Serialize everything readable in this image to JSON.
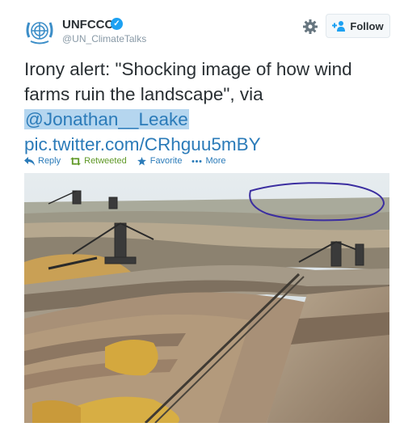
{
  "account": {
    "name": "UNFCCC",
    "handle": "@UN_ClimateTalks",
    "verified_mark": "✓"
  },
  "header": {
    "follow_label": "Follow"
  },
  "tweet": {
    "text_line1": "Irony alert: \"Shocking image of how wind",
    "text_line2": "farms ruin the landscape\", via",
    "mention": "@Jonathan__Leake",
    "link": "pic.twitter.com/CRhguu5mBY"
  },
  "actions": [
    {
      "label": "Reply",
      "icon": "reply-icon"
    },
    {
      "label": "Retweeted",
      "icon": "retweet-icon"
    },
    {
      "label": "Favorite",
      "icon": "star-icon"
    },
    {
      "label": "More",
      "icon": "more-dots-icon"
    }
  ],
  "colors": {
    "link": "#2b7bb9",
    "retweeted": "#609928",
    "annotation": "#3b2ea0"
  }
}
